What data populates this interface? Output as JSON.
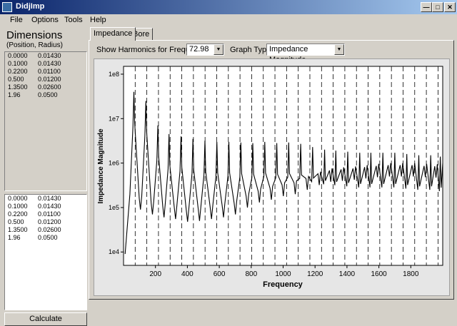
{
  "window": {
    "title": "DidjImp"
  },
  "menu": {
    "file": "File",
    "options": "Options",
    "tools": "Tools",
    "help": "Help"
  },
  "dimensions": {
    "title": "Dimensions",
    "subtitle": "(Position, Radius)",
    "top_rows": [
      [
        "0.0000",
        "0.01430"
      ],
      [
        "0.1000",
        "0.01430"
      ],
      [
        "0.2200",
        "0.01100"
      ],
      [
        "0.500",
        "0.01200"
      ],
      [
        "1.3500",
        "0.02600"
      ],
      [
        "1.96",
        "0.0500"
      ]
    ],
    "bottom_rows": [
      [
        "0.0000",
        "0.01430"
      ],
      [
        "0.1000",
        "0.01430"
      ],
      [
        "0.2200",
        "0.01100"
      ],
      [
        "0.500",
        "0.01200"
      ],
      [
        "1.3500",
        "0.02600"
      ],
      [
        "1.96",
        "0.0500"
      ]
    ],
    "calculate_label": "Calculate"
  },
  "tabs": {
    "impedance": "Impedance",
    "bore": "Bore"
  },
  "controls": {
    "harmonics_label": "Show Harmonics for Frequency:",
    "harmonics_value": "72.98",
    "graph_type_label": "Graph Type:",
    "graph_type_value": "Impedance Magnitude"
  },
  "chart_data": {
    "type": "line",
    "xlabel": "Frequency",
    "ylabel": "Impedance Magnitude",
    "xlim": [
      0,
      2000
    ],
    "ylim": [
      5000,
      150000000
    ],
    "yscale": "log",
    "x_ticks": [
      "200",
      "400",
      "600",
      "800",
      "1000",
      "1200",
      "1400",
      "1600",
      "1800"
    ],
    "y_ticks": [
      "1e4",
      "1e5",
      "1e6",
      "1e7",
      "1e8"
    ],
    "harmonic_lines_x": [
      72.98,
      145.96,
      218.94,
      291.92,
      364.9,
      437.88,
      510.86,
      583.84,
      656.82,
      729.8,
      802.78,
      875.76,
      948.74,
      1021.72,
      1094.7,
      1167.68,
      1240.66,
      1313.64,
      1386.62,
      1459.6,
      1532.58,
      1605.56,
      1678.54,
      1751.52,
      1824.5,
      1897.48,
      1970.46
    ],
    "resonances": [
      {
        "x": 65,
        "peak": 40000000,
        "trough": 90000
      },
      {
        "x": 140,
        "peak": 25000000,
        "trough": 70000
      },
      {
        "x": 215,
        "peak": 7000000,
        "trough": 60000
      },
      {
        "x": 285,
        "peak": 4500000,
        "trough": 55000
      },
      {
        "x": 360,
        "peak": 4000000,
        "trough": 48000
      },
      {
        "x": 435,
        "peak": 3500000,
        "trough": 50000
      },
      {
        "x": 510,
        "peak": 3200000,
        "trough": 55000
      },
      {
        "x": 585,
        "peak": 3000000,
        "trough": 60000
      },
      {
        "x": 660,
        "peak": 3000000,
        "trough": 70000
      },
      {
        "x": 735,
        "peak": 2900000,
        "trough": 100000
      },
      {
        "x": 810,
        "peak": 2800000,
        "trough": 130000
      },
      {
        "x": 885,
        "peak": 3000000,
        "trough": 150000
      },
      {
        "x": 960,
        "peak": 2800000,
        "trough": 180000
      },
      {
        "x": 1035,
        "peak": 2900000,
        "trough": 200000
      },
      {
        "x": 1110,
        "peak": 2700000,
        "trough": 250000
      },
      {
        "x": 1185,
        "peak": 2300000,
        "trough": 320000
      },
      {
        "x": 1260,
        "peak": 2000000,
        "trough": 380000
      },
      {
        "x": 1330,
        "peak": 1900000,
        "trough": 400000
      },
      {
        "x": 1405,
        "peak": 1800000,
        "trough": 420000
      },
      {
        "x": 1480,
        "peak": 1700000,
        "trough": 450000
      },
      {
        "x": 1550,
        "peak": 1700000,
        "trough": 480000
      },
      {
        "x": 1625,
        "peak": 1700000,
        "trough": 500000
      },
      {
        "x": 1700,
        "peak": 1700000,
        "trough": 500000
      },
      {
        "x": 1775,
        "peak": 1600000,
        "trough": 500000
      },
      {
        "x": 1850,
        "peak": 1500000,
        "trough": 480000
      },
      {
        "x": 1925,
        "peak": 1500000,
        "trough": 470000
      },
      {
        "x": 1985,
        "peak": 1400000,
        "trough": 460000
      }
    ],
    "grid": false,
    "colors": {
      "line": "#000000",
      "plot_bg": "#ffffff",
      "area_bg": "#e6e6e6"
    }
  }
}
